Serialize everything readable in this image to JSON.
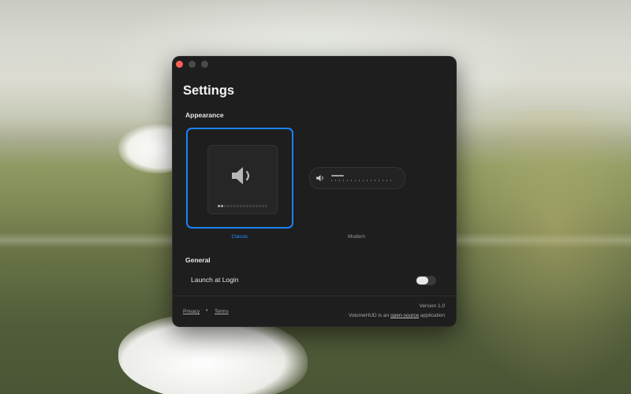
{
  "window": {
    "title": "Settings"
  },
  "appearance": {
    "section_label": "Appearance",
    "selected": "Classic",
    "options": [
      {
        "label": "Classic",
        "icon": "speaker-icon",
        "level": 0.15
      },
      {
        "label": "Modern",
        "icon": "speaker-icon",
        "level": 0.2
      }
    ]
  },
  "general": {
    "section_label": "General",
    "launch_at_login": {
      "label": "Launch at Login",
      "enabled": false
    }
  },
  "footer": {
    "privacy": "Privacy",
    "separator": "•",
    "terms": "Terms",
    "version": "Version 1.0",
    "credit_prefix": "VolumeHUD is an",
    "credit_link": "open-source",
    "credit_suffix": "application"
  },
  "colors": {
    "accent": "#1a82ff",
    "window_bg": "#1e1e1e",
    "close_button": "#ff5f57"
  }
}
